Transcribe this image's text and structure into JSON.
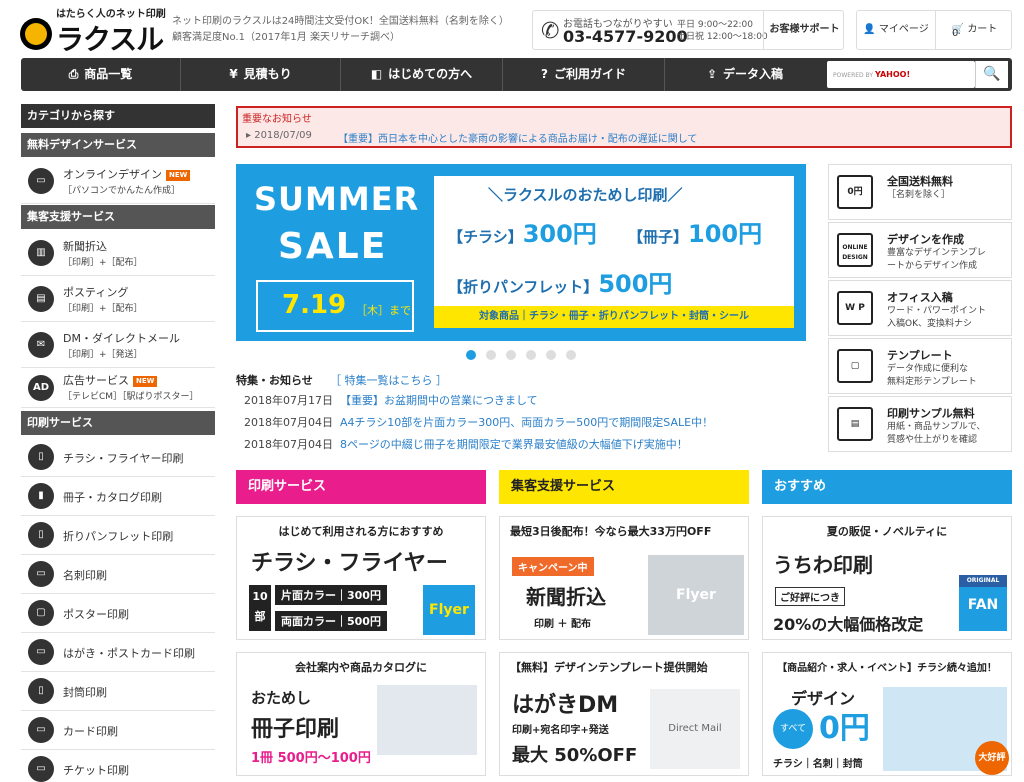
{
  "header": {
    "logo_tag": "はたらく人のネット印刷",
    "logo_text": "ラクスル",
    "tagline_1": "ネット印刷のラクスルは24時間注文受付OK！全国送料無料（名刺を除く）",
    "tagline_2": "顧客満足度No.1（2017年1月 楽天リサーチ調べ）",
    "phone_label": "お電話もつながりやすい",
    "phone_number": "03-4577-9200",
    "hours_1": "平日 9:00～22:00",
    "hours_2": "土日祝 12:00～18:00",
    "support": "お客様サポート",
    "mypage": "マイページ",
    "cart": "カート",
    "cart_count": "0"
  },
  "nav": {
    "items": [
      {
        "label": "商品一覧",
        "icon": "printer-icon"
      },
      {
        "label": "見積もり",
        "icon": "yen-icon"
      },
      {
        "label": "はじめての方へ",
        "icon": "beginner-icon"
      },
      {
        "label": "ご利用ガイド",
        "icon": "question-icon"
      },
      {
        "label": "データ入稿",
        "icon": "upload-icon"
      }
    ],
    "search_powered": "POWERED BY",
    "search_brand": "YAHOO!"
  },
  "sidebar": {
    "title": "カテゴリから探す",
    "sections": [
      {
        "header": "無料デザインサービス"
      },
      {
        "header": "集客支援サービス"
      },
      {
        "header": "印刷サービス"
      }
    ],
    "design_items": [
      {
        "label": "オンラインデザイン",
        "sub": "［パソコンでかんたん作成］",
        "new": "NEW"
      }
    ],
    "promo_items": [
      {
        "label": "新聞折込",
        "sub": "［印刷］+［配布］"
      },
      {
        "label": "ポスティング",
        "sub": "［印刷］+［配布］"
      },
      {
        "label": "DM・ダイレクトメール",
        "sub": "［印刷］+［発送］"
      },
      {
        "label": "広告サービス",
        "sub": "［テレビCM］［駅ばりポスター］",
        "new": "NEW",
        "icon_text": "AD"
      }
    ],
    "print_items": [
      {
        "label": "チラシ・フライヤー印刷"
      },
      {
        "label": "冊子・カタログ印刷"
      },
      {
        "label": "折りパンフレット印刷"
      },
      {
        "label": "名刺印刷"
      },
      {
        "label": "ポスター印刷"
      },
      {
        "label": "はがき・ポストカード印刷"
      },
      {
        "label": "封筒印刷"
      },
      {
        "label": "カード印刷"
      },
      {
        "label": "チケット印刷"
      }
    ]
  },
  "notice": {
    "title": "重要なお知らせ",
    "date": "2018/07/09",
    "text": "【重要】西日本を中心とした豪雨の影響による商品お届け・配布の遅延に関して"
  },
  "banner": {
    "summer": "SUMMER",
    "sale": "SALE",
    "date": "7.19",
    "date_sub": "［木］まで",
    "headline": "＼ラクスルのおためし印刷／",
    "item1": "【チラシ】",
    "price1": "300円",
    "item2": "【冊子】",
    "price2": "100円",
    "item3": "【折りパンフレット】",
    "price3": "500円",
    "products": "対象商品｜チラシ・冊子・折りパンフレット・封筒・シール",
    "active_slide": 1
  },
  "news": {
    "header": "特集・お知らせ",
    "link": "［ 特集一覧はこちら ］",
    "items": [
      {
        "date": "2018年07月17日",
        "text": "【重要】お盆期間中の営業につきまして"
      },
      {
        "date": "2018年07月04日",
        "text": "A4チラシ10部を片面カラー300円、両面カラー500円で期間限定SALE中！"
      },
      {
        "date": "2018年07月04日",
        "text": "8ページの中綴じ冊子を期間限定で業界最安値級の大幅値下げ実施中！"
      }
    ]
  },
  "features": [
    {
      "title": "全国送料無料",
      "sub1": "［名刺を除く］",
      "sub2": "",
      "icon_text": "0円"
    },
    {
      "title": "デザインを作成",
      "sub1": "豊富なデザインテンプレ",
      "sub2": "ートからデザイン作成",
      "icon_text": "ONLINE DESIGN"
    },
    {
      "title": "オフィス入稿",
      "sub1": "ワード・パワーポイント",
      "sub2": "入稿OK、変換料ナシ",
      "icon_text": "W P"
    },
    {
      "title": "テンプレート",
      "sub1": "データ作成に便利な",
      "sub2": "無料定形テンプレート",
      "icon_text": "▢"
    },
    {
      "title": "印刷サンプル無料",
      "sub1": "用紙・商品サンプルで、",
      "sub2": "質感や仕上がりを確認",
      "icon_text": "▤"
    }
  ],
  "sections": [
    {
      "title": "印刷サービス",
      "cards": [
        {
          "top": "はじめて利用される方におすすめ",
          "big": "チラシ・フライヤー",
          "qty": "10部",
          "line1": "片面カラー｜300円",
          "line2": "両面カラー｜500円",
          "img": "Flyer"
        },
        {
          "top": "会社案内や商品カタログに",
          "big1": "おためし",
          "big2": "冊子印刷",
          "price": "1冊 500円～100円"
        }
      ]
    },
    {
      "title": "集客支援サービス",
      "cards": [
        {
          "top": "最短3日後配布！今なら最大33万円OFF",
          "campaign": "キャンペーン中",
          "big": "新聞折込",
          "tags": "印刷 ＋ 配布",
          "img": "Flyer"
        },
        {
          "top": "【無料】デザインテンプレート提供開始",
          "big": "はがきDM",
          "small": "印刷+宛名印字+発送",
          "off": "最大 50%OFF",
          "img": "Direct Mail"
        }
      ]
    },
    {
      "title": "おすすめ",
      "cards": [
        {
          "top": "夏の販促・ノベルティに",
          "big": "うちわ印刷",
          "small": "ご好評につき",
          "bottom": "20%の大幅価格改定",
          "img": "FAN",
          "img_tag": "ORIGINAL"
        },
        {
          "top": "【商品紹介・求人・イベント】チラシ続々追加！",
          "big": "デザイン",
          "zero": "0円",
          "tags": "チラシ｜名刺｜封筒",
          "bubble": "すべて",
          "badge": "大好評"
        }
      ]
    }
  ]
}
